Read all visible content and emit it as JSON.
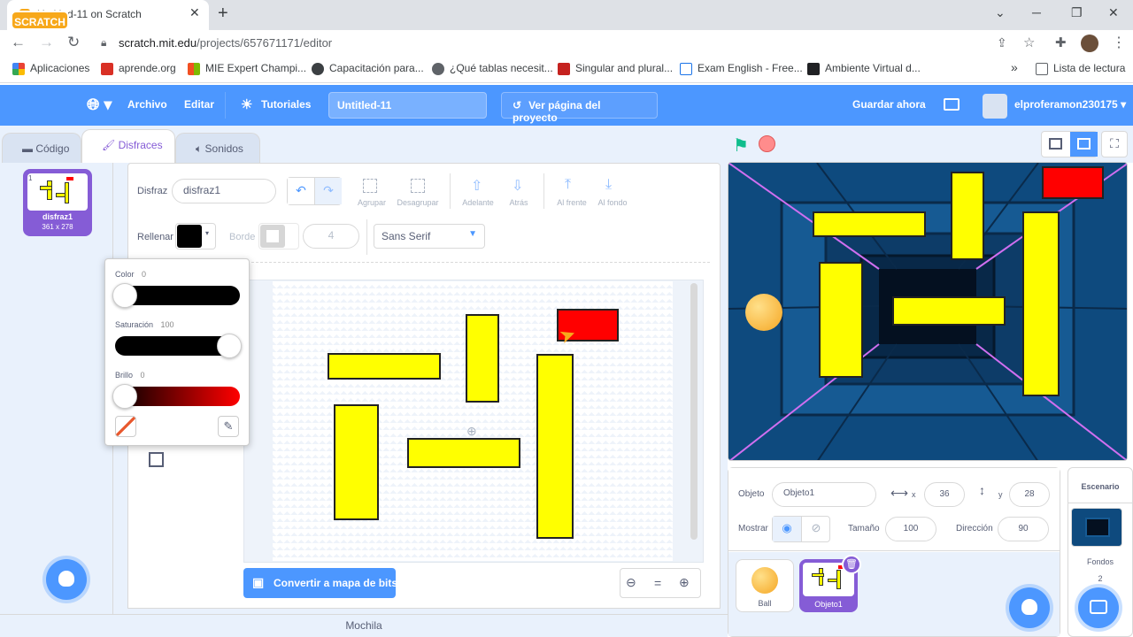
{
  "browser": {
    "tab_title": "Untitled-11 on Scratch",
    "url_domain": "scratch.mit.edu",
    "url_path": "/projects/657671171/editor",
    "bookmarks": [
      {
        "label": "Aplicaciones",
        "color": "#ea4335"
      },
      {
        "label": "aprende.org",
        "color": "#d93025"
      },
      {
        "label": "MIE Expert Champi...",
        "color": "#f25022"
      },
      {
        "label": "Capacitación para...",
        "color": "#3c4043"
      },
      {
        "label": "¿Qué tablas necesit...",
        "color": "#5f6368"
      },
      {
        "label": "Singular and plural...",
        "color": "#c5221f"
      },
      {
        "label": "Exam English - Free...",
        "color": "#1a73e8"
      },
      {
        "label": "Ambiente Virtual d...",
        "color": "#202124"
      }
    ],
    "reading_list": "Lista de lectura"
  },
  "menubar": {
    "logo": "SCRATCH",
    "archivo": "Archivo",
    "editar": "Editar",
    "tutoriales": "Tutoriales",
    "project_title": "Untitled-11",
    "see_page": "Ver página del proyecto",
    "save_now": "Guardar ahora",
    "username": "elproferamon230175"
  },
  "tabs": {
    "code": "Código",
    "costumes": "Disfraces",
    "sounds": "Sonidos"
  },
  "costume": {
    "index": "1",
    "name": "disfraz1",
    "size": "361 x 278"
  },
  "paint": {
    "costume_label": "Disfraz",
    "costume_name": "disfraz1",
    "group": "Agrupar",
    "ungroup": "Desagrupar",
    "forward": "Adelante",
    "backward": "Atrás",
    "front": "Al frente",
    "back": "Al fondo",
    "fill_label": "Rellenar",
    "border_label": "Borde",
    "border_width": "4",
    "font": "Sans Serif",
    "convert_bitmap": "Convertir a mapa de bits",
    "zoom_reset": "="
  },
  "color_popup": {
    "color_label": "Color",
    "color_value": "0",
    "saturation_label": "Saturación",
    "saturation_value": "100",
    "brightness_label": "Brillo",
    "brightness_value": "0"
  },
  "backpack": "Mochila",
  "sprite_info": {
    "object_label": "Objeto",
    "object_name": "Objeto1",
    "x_label": "x",
    "x_value": "36",
    "y_label": "y",
    "y_value": "28",
    "show_label": "Mostrar",
    "size_label": "Tamaño",
    "size_value": "100",
    "direction_label": "Dirección",
    "direction_value": "90"
  },
  "sprites": [
    {
      "name": "Ball"
    },
    {
      "name": "Objeto1"
    }
  ],
  "stage_panel": {
    "title": "Escenario",
    "backdrops_label": "Fondos",
    "backdrops_count": "2"
  },
  "colors": {
    "scratch_blue": "#4c97ff",
    "purple": "#855cd6",
    "yellow": "#ffff00",
    "red": "#ff0000"
  }
}
